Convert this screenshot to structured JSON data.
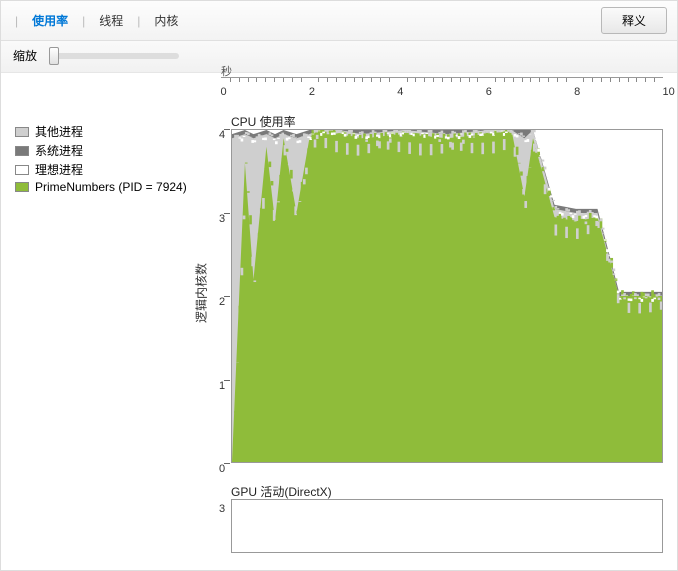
{
  "toolbar": {
    "tabs": [
      "使用率",
      "线程",
      "内核"
    ],
    "active_tab": 0,
    "button_label": "释义"
  },
  "zoom": {
    "label": "缩放"
  },
  "time_axis": {
    "label": "秒",
    "ticks": [
      0,
      2,
      4,
      6,
      8,
      10
    ]
  },
  "legend": {
    "items": [
      {
        "label": "其他进程",
        "color": "#cfcfcf"
      },
      {
        "label": "系统进程",
        "color": "#7a7a7a"
      },
      {
        "label": "理想进程",
        "color": "#ffffff"
      },
      {
        "label": "PrimeNumbers (PID = 7924)",
        "color": "#8fbc3a"
      }
    ]
  },
  "cpu_chart": {
    "title": "CPU 使用率",
    "y_label": "逻辑内核数",
    "y_ticks": [
      0,
      1,
      2,
      3,
      4
    ]
  },
  "gpu_chart": {
    "title": "GPU 活动(DirectX)",
    "y_ticks": [
      3
    ]
  },
  "chart_data": [
    {
      "type": "area",
      "title": "CPU 使用率",
      "xlabel": "秒",
      "ylabel": "逻辑内核数",
      "xlim": [
        0,
        10
      ],
      "ylim": [
        0,
        4
      ],
      "x": [
        0,
        0.3,
        0.5,
        0.8,
        1.0,
        1.2,
        1.5,
        1.8,
        2.0,
        2.5,
        3.0,
        4.0,
        5.0,
        6.0,
        6.5,
        6.8,
        7.0,
        7.5,
        8.0,
        8.5,
        9.0,
        9.5,
        10.0
      ],
      "series": [
        {
          "name": "PrimeNumbers (PID = 7924)",
          "color": "#8fbc3a",
          "values": [
            0,
            3.6,
            2.2,
            3.8,
            2.9,
            3.9,
            3.0,
            3.9,
            4.0,
            3.95,
            3.9,
            3.95,
            3.9,
            3.95,
            4.0,
            3.2,
            3.9,
            2.95,
            2.9,
            2.95,
            2.0,
            2.0,
            2.0
          ]
        },
        {
          "name": "其他进程",
          "color": "#cfcfcf",
          "values": [
            3.9,
            3.95,
            3.9,
            3.95,
            3.9,
            3.95,
            3.9,
            3.95,
            4.0,
            4.0,
            3.95,
            4.0,
            3.95,
            4.0,
            4.0,
            3.9,
            4.0,
            3.05,
            3.0,
            3.0,
            2.0,
            2.0,
            2.0
          ]
        },
        {
          "name": "系统进程",
          "color": "#7a7a7a",
          "values": [
            3.95,
            4.0,
            3.95,
            4.0,
            3.95,
            4.0,
            3.95,
            4.0,
            4.0,
            4.0,
            4.0,
            4.0,
            4.0,
            4.0,
            4.0,
            4.0,
            4.0,
            3.1,
            3.05,
            3.05,
            2.05,
            2.05,
            2.05
          ]
        },
        {
          "name": "理想进程",
          "color": "#ffffff",
          "values": [
            4,
            4,
            4,
            4,
            4,
            4,
            4,
            4,
            4,
            4,
            4,
            4,
            4,
            4,
            4,
            4,
            4,
            4,
            4,
            4,
            4,
            4,
            4
          ]
        }
      ]
    },
    {
      "type": "area",
      "title": "GPU 活动(DirectX)",
      "xlim": [
        0,
        10
      ],
      "ylim": [
        0,
        3
      ],
      "x": [
        0,
        10
      ],
      "series": [
        {
          "name": "GPU",
          "color": "#8fbc3a",
          "values": [
            0,
            0
          ]
        }
      ]
    }
  ]
}
